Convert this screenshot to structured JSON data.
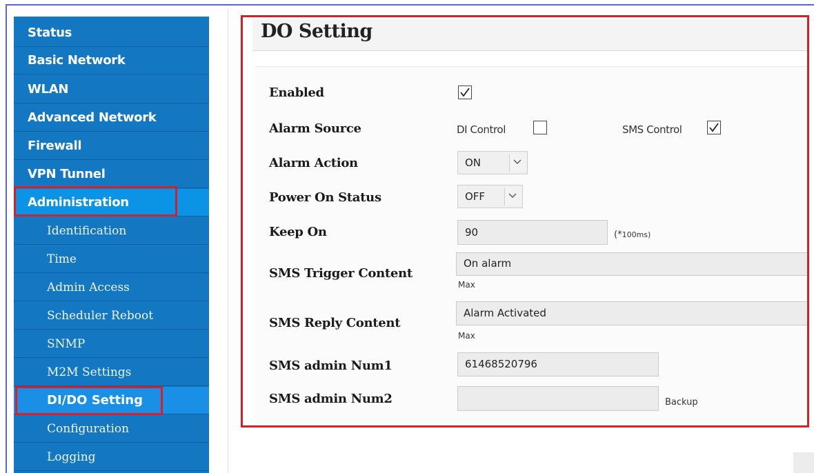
{
  "sidebar": {
    "items": [
      {
        "label": "Status"
      },
      {
        "label": "Basic Network"
      },
      {
        "label": "WLAN"
      },
      {
        "label": "Advanced Network"
      },
      {
        "label": "Firewall"
      },
      {
        "label": "VPN Tunnel"
      },
      {
        "label": "Administration"
      }
    ],
    "subitems": [
      {
        "label": "Identification"
      },
      {
        "label": "Time"
      },
      {
        "label": "Admin Access"
      },
      {
        "label": "Scheduler Reboot"
      },
      {
        "label": "SNMP"
      },
      {
        "label": "M2M Settings"
      },
      {
        "label": "DI/DO Setting"
      },
      {
        "label": "Configuration"
      },
      {
        "label": "Logging"
      }
    ]
  },
  "page": {
    "title": "DO Setting"
  },
  "form": {
    "enabled": {
      "label": "Enabled",
      "checked": true
    },
    "alarm_source": {
      "label": "Alarm Source",
      "di_label": "DI Control",
      "di_checked": false,
      "sms_label": "SMS Control",
      "sms_checked": true
    },
    "alarm_action": {
      "label": "Alarm Action",
      "value": "ON"
    },
    "power_on_status": {
      "label": "Power On Status",
      "value": "OFF"
    },
    "keep_on": {
      "label": "Keep On",
      "value": "90",
      "unit_prefix": "(*",
      "unit_suffix": "100ms)"
    },
    "sms_trigger": {
      "label": "SMS Trigger Content",
      "value": "On alarm",
      "hint": "Max"
    },
    "sms_reply": {
      "label": "SMS Reply Content",
      "value": "Alarm Activated",
      "hint": "Max"
    },
    "admin_num1": {
      "label": "SMS admin Num1",
      "value": "61468520796"
    },
    "admin_num2": {
      "label": "SMS admin Num2",
      "value": "",
      "hint": "Backup"
    }
  },
  "colors": {
    "sidebar_bg": "#1377c2",
    "active_bg": "#0b93e6",
    "highlight": "#d3202a"
  }
}
